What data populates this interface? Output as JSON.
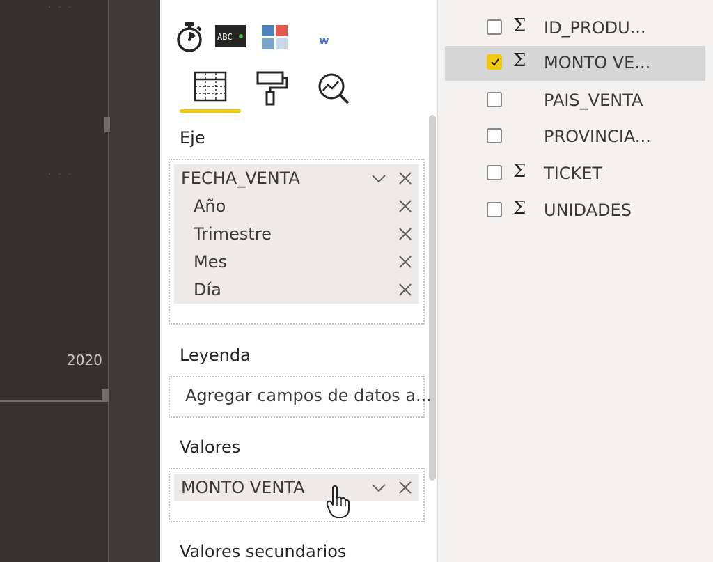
{
  "canvas": {
    "axis_label": "2020"
  },
  "viz_pane": {
    "icons": [
      "stopwatch-icon",
      "kpi-card-icon",
      "matrix-visual-icon",
      "word-visual-icon"
    ],
    "word_visual_letter": "w",
    "tabs": [
      {
        "name": "fields-tab",
        "icon": "table-grid-icon",
        "active": true
      },
      {
        "name": "format-tab",
        "icon": "paint-roller-icon",
        "active": false
      },
      {
        "name": "analytics-tab",
        "icon": "magnifier-chart-icon",
        "active": false
      }
    ],
    "eje": {
      "label": "Eje",
      "group": "FECHA_VENTA",
      "items": [
        "Año",
        "Trimestre",
        "Mes",
        "Día"
      ]
    },
    "leyenda": {
      "label": "Leyenda",
      "placeholder": "Agregar campos de datos a..."
    },
    "valores": {
      "label": "Valores",
      "field": "MONTO VENTA"
    },
    "valores_secundarios": {
      "label": "Valores secundarios"
    }
  },
  "fields_pane": {
    "items": [
      {
        "name": "ID_PRODU...",
        "checked": false,
        "sigma": true
      },
      {
        "name": "MONTO VE...",
        "checked": true,
        "sigma": true
      },
      {
        "name": "PAIS_VENTA",
        "checked": false,
        "sigma": false
      },
      {
        "name": "PROVINCIA...",
        "checked": false,
        "sigma": false
      },
      {
        "name": "TICKET",
        "checked": false,
        "sigma": true
      },
      {
        "name": "UNIDADES",
        "checked": false,
        "sigma": true
      }
    ],
    "sigma_symbol": "Σ"
  },
  "colors": {
    "accent": "#f2c811",
    "canvas_dark": "#3b3a39",
    "pane_white": "#ffffff",
    "pane_gray": "#f3f2f1"
  }
}
